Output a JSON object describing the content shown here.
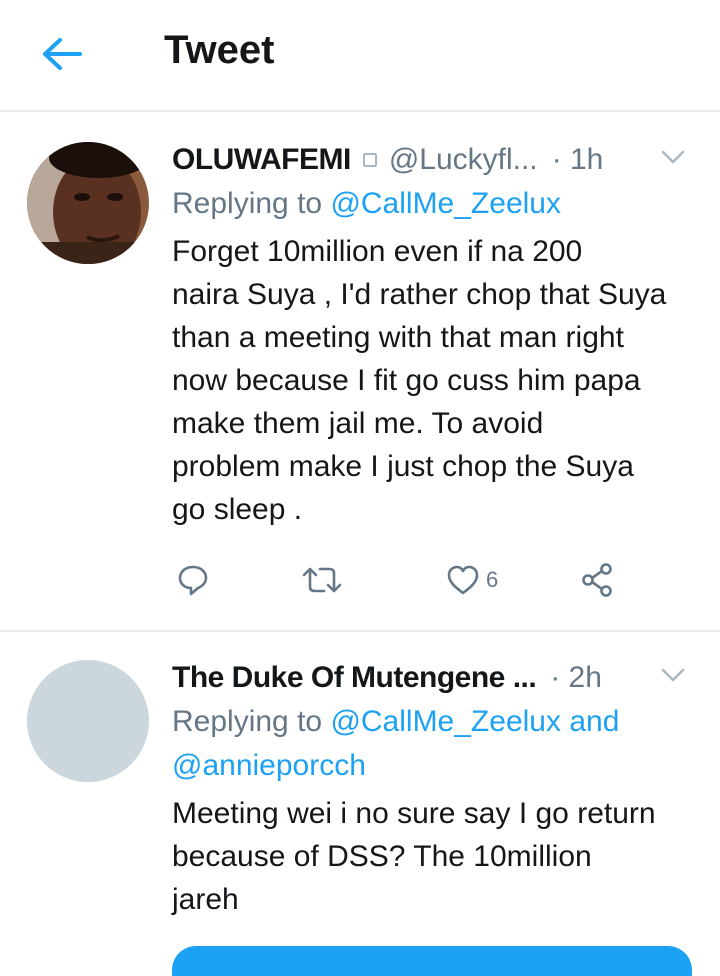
{
  "header": {
    "title": "Tweet",
    "back_icon": "arrow-left-icon",
    "accent_color": "#1da1f2"
  },
  "tweets": [
    {
      "display_name": "OLUWAFEMI",
      "handle": "@Luckyfl...",
      "time": "· 1h",
      "replying_prefix": "Replying to",
      "replying_to": "@CallMe_Zeelux",
      "text": "Forget 10million even if na 200\nnaira Suya , I'd rather chop that Suya\nthan a meeting with that man right\nnow because I fit go cuss him papa\nmake them jail me. To avoid\nproblem make I just chop the Suya\ngo sleep .",
      "like_count": "6",
      "icons": [
        "reply-icon",
        "retweet-icon",
        "heart-icon",
        "share-icon"
      ]
    },
    {
      "display_name": "The Duke Of Mutengene ...",
      "time": "· 2h",
      "replying_prefix": "Replying to",
      "replying_to": "@CallMe_Zeelux",
      "replying_and": "and",
      "replying_to_2": "@annieporcch",
      "text": "Meeting wei i no sure say I go return\nbecause of DSS? The 10million\njareh"
    }
  ]
}
